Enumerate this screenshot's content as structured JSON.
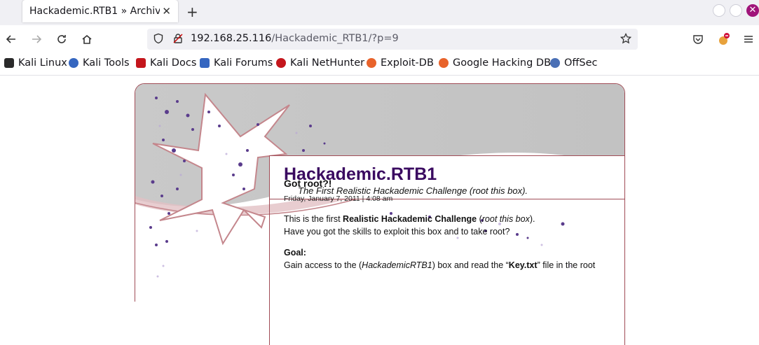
{
  "browser": {
    "tab_title": "Hackademic.RTB1 » Archives",
    "tab_close": "✕",
    "new_tab": "+",
    "url_host": "192.168.25.116",
    "url_path": "/Hackademic_RTB1/?p=9",
    "bookmarks": [
      {
        "label": "Kali Linux",
        "color": "#2a2a2a"
      },
      {
        "label": "Kali Tools",
        "color": "#3566c0"
      },
      {
        "label": "Kali Docs",
        "color": "#c4161c"
      },
      {
        "label": "Kali Forums",
        "color": "#3566c0"
      },
      {
        "label": "Kali NetHunter",
        "color": "#c4161c"
      },
      {
        "label": "Exploit-DB",
        "color": "#e8632b"
      },
      {
        "label": "Google Hacking DB",
        "color": "#e8632b"
      },
      {
        "label": "OffSec",
        "color": "#4a6fb5"
      }
    ]
  },
  "site": {
    "title": "Hackademic.RTB1",
    "description": "The First Realistic Hackademic Challenge (root this box).",
    "accent": "#3a0a60",
    "border_color": "#a04c56"
  },
  "post": {
    "title": "Got root?!",
    "date": "Friday, January 7, 2011 | 4:08 am",
    "line1_pre": "This is the first ",
    "line1_bold": "Realistic Hackademic Challenge",
    "line1_mid": " (",
    "line1_italic": "root this box",
    "line1_post": ").",
    "line2": "Have you got the skills to exploit this box and to take root?",
    "goal_label": "Goal:",
    "goal_pre": "Gain access to the (",
    "goal_italic": "HackademicRTB1",
    "goal_mid": ") box and read the  “",
    "goal_bold": "Key.txt",
    "goal_post": "”  file in the root"
  }
}
